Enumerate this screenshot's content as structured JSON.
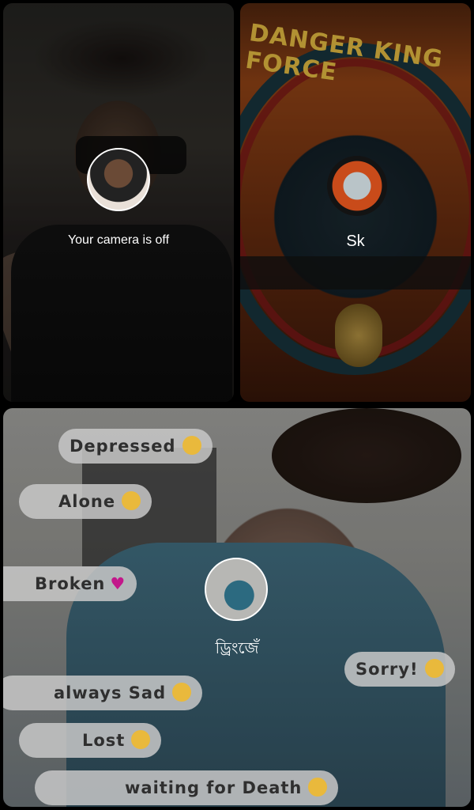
{
  "tiles": {
    "self": {
      "status_text": "Your camera is off"
    },
    "participant_1": {
      "name": "Sk",
      "background_banner": "DANGER KING FORCE"
    },
    "participant_2": {
      "name": "ড্ৰিংজেঁ",
      "background_labels": [
        "Depressed",
        "Alone",
        "Broken",
        "always Sad",
        "Lost",
        "waiting for Death",
        "Sorry!"
      ]
    }
  },
  "colors": {
    "background": "#000000",
    "text": "#ffffff"
  },
  "icons": [
    "avatar-self",
    "avatar-sk",
    "avatar-group"
  ]
}
